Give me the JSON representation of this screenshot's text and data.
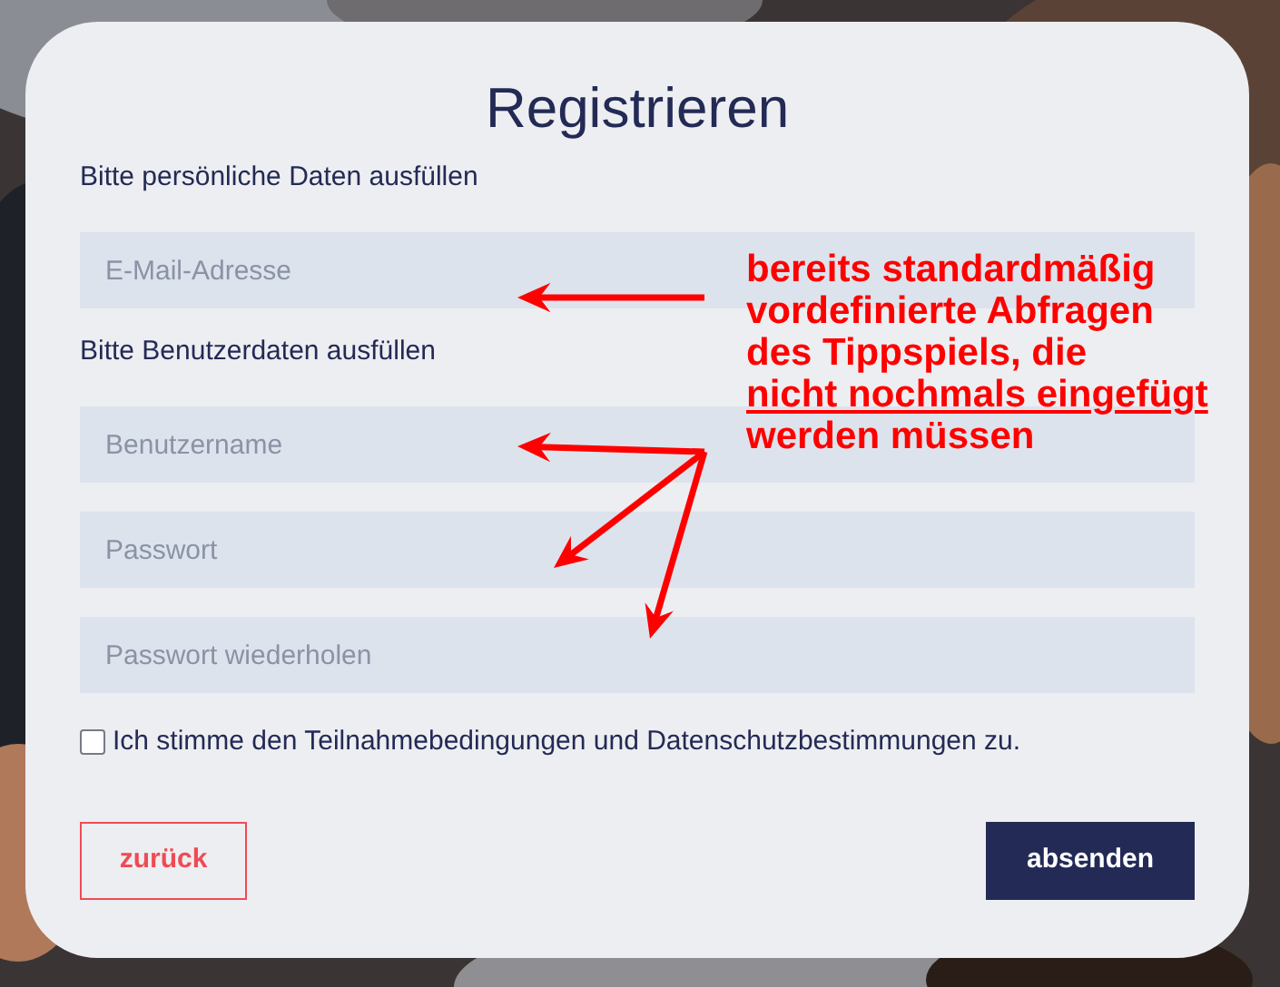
{
  "title": "Registrieren",
  "sections": [
    {
      "heading": "Bitte persönliche Daten ausfüllen",
      "fields": [
        {
          "placeholder": "E-Mail-Adresse"
        }
      ]
    },
    {
      "heading": "Bitte Benutzerdaten ausfüllen",
      "fields": [
        {
          "placeholder": "Benutzername"
        },
        {
          "placeholder": "Passwort"
        },
        {
          "placeholder": "Passwort wiederholen"
        }
      ]
    }
  ],
  "consent": {
    "label": "Ich stimme den Teilnahmebedingungen und Datenschutzbestimmungen zu.",
    "checked": false
  },
  "buttons": [
    {
      "label": "zurück",
      "kind": "outline"
    },
    {
      "label": "absenden",
      "kind": "primary"
    }
  ],
  "annotation": {
    "lines": [
      {
        "text": "bereits standardmäßig",
        "underlined": false
      },
      {
        "text": "vordefinierte Abfragen",
        "underlined": false
      },
      {
        "text": "des Tippspiels, die",
        "underlined": false
      },
      {
        "text": "nicht nochmals eingefügt",
        "underlined": true
      },
      {
        "text": "werden müssen",
        "underlined": false
      }
    ]
  }
}
